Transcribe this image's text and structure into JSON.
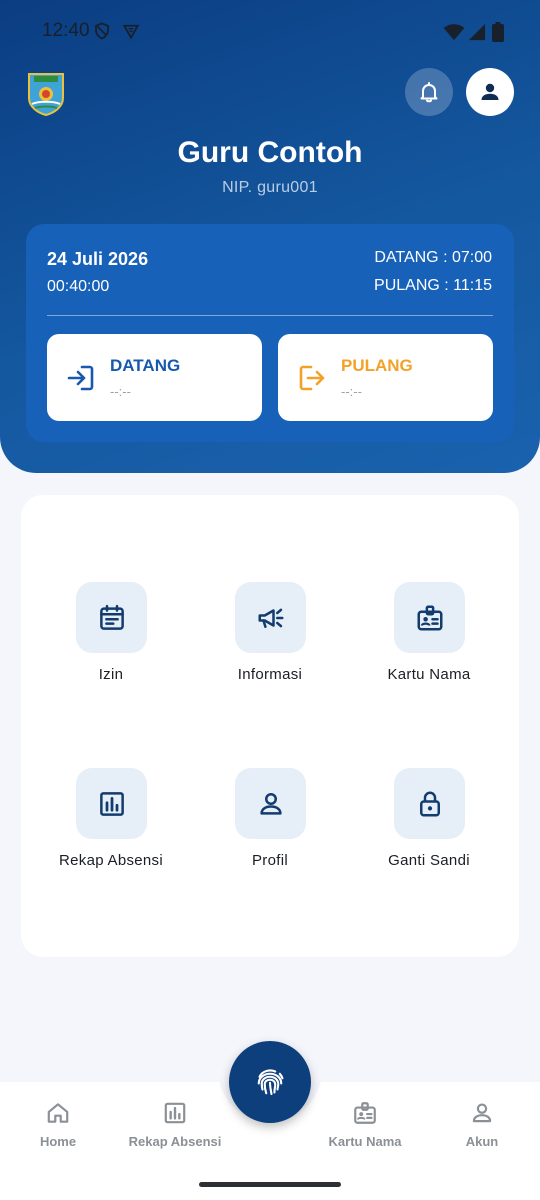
{
  "status_bar": {
    "time": "12:40"
  },
  "header": {
    "name": "Guru Contoh",
    "nip": "NIP. guru001"
  },
  "attendance_card": {
    "date": "24 Juli 2026",
    "clock": "00:40:00",
    "datang_schedule": "DATANG : 07:00",
    "pulang_schedule": "PULANG : 11:15",
    "datang": {
      "label": "DATANG",
      "time": "--:--"
    },
    "pulang": {
      "label": "PULANG",
      "time": "--:--"
    }
  },
  "menu": [
    {
      "label": "Izin",
      "icon": "calendar-list-icon"
    },
    {
      "label": "Informasi",
      "icon": "megaphone-icon"
    },
    {
      "label": "Kartu Nama",
      "icon": "id-badge-icon"
    },
    {
      "label": "Rekap Absensi",
      "icon": "bar-chart-icon"
    },
    {
      "label": "Profil",
      "icon": "person-icon"
    },
    {
      "label": "Ganti Sandi",
      "icon": "lock-icon"
    }
  ],
  "bottom_nav": [
    {
      "label": "Home",
      "icon": "home-icon"
    },
    {
      "label": "Rekap Absensi",
      "icon": "bar-chart-icon"
    },
    {
      "label": "Kartu Nama",
      "icon": "id-badge-icon"
    },
    {
      "label": "Akun",
      "icon": "person-icon"
    }
  ],
  "colors": {
    "header_dark": "#0b3d82",
    "card_blue": "#1761b8",
    "datang_blue": "#1759ad",
    "pulang_orange": "#f2a229",
    "fab": "#0c3f7c",
    "icon_dark": "#123c6e"
  }
}
